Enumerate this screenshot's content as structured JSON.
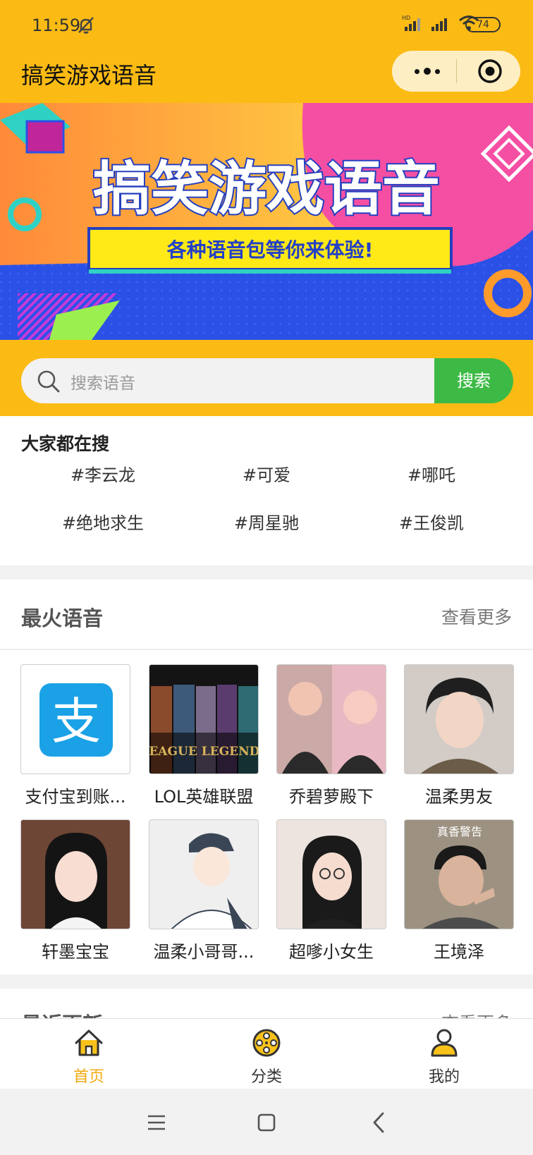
{
  "status_bar": {
    "time": "11:59",
    "network": "HD",
    "battery": "74"
  },
  "nav": {
    "title": "搞笑游戏语音"
  },
  "banner": {
    "title": "搞笑游戏语音",
    "subtitle": "各种语音包等你来体验!"
  },
  "search": {
    "placeholder": "搜索语音",
    "button": "搜索"
  },
  "hot_searches": {
    "title": "大家都在搜",
    "tags": [
      "#李云龙",
      "#可爱",
      "#哪吒",
      "#绝地求生",
      "#周星驰",
      "#王俊凯"
    ]
  },
  "hottest": {
    "title": "最火语音",
    "more": "查看更多",
    "items": [
      {
        "name": "支付宝到账...",
        "badge": "支"
      },
      {
        "name": "LOL英雄联盟",
        "badge": "LEAGUE LEGENDS"
      },
      {
        "name": "乔碧萝殿下"
      },
      {
        "name": "温柔男友"
      },
      {
        "name": "轩墨宝宝"
      },
      {
        "name": "温柔小哥哥..."
      },
      {
        "name": "超嗲小女生"
      },
      {
        "name": "王境泽",
        "badge": "真香警告"
      }
    ]
  },
  "recent": {
    "title": "最近更新",
    "more": "查看更多"
  },
  "tabbar": {
    "tabs": [
      {
        "label": "首页"
      },
      {
        "label": "分类"
      },
      {
        "label": "我的"
      }
    ]
  },
  "colors": {
    "primary": "#fbbb14",
    "search_button": "#3dba45",
    "active_tab": "#f1a90f"
  }
}
